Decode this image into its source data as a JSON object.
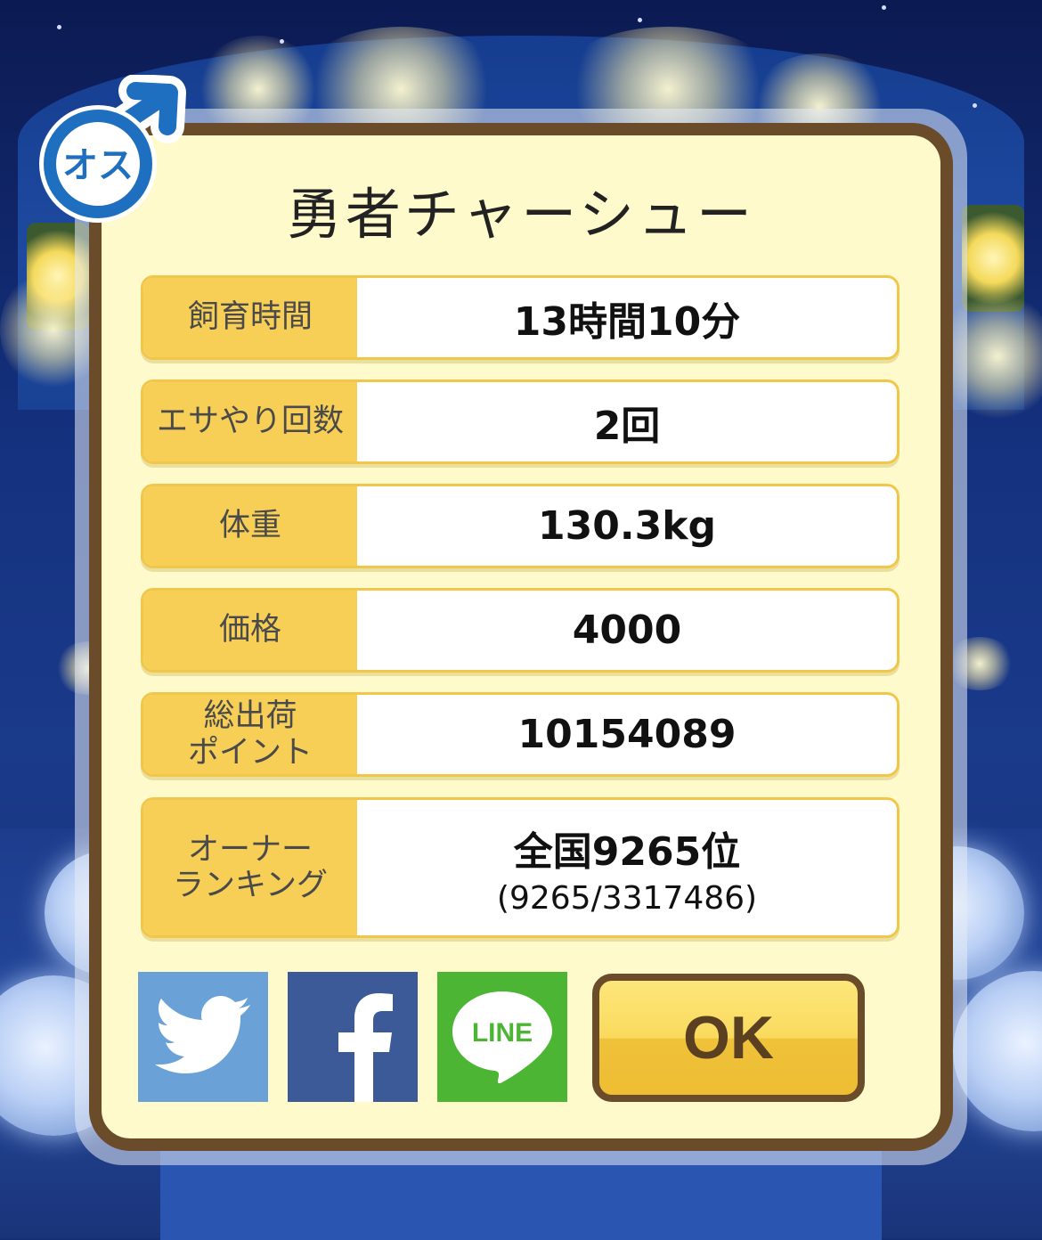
{
  "pig": {
    "name": "勇者チャーシュー",
    "gender_badge": "オス"
  },
  "stats": [
    {
      "label": "飼育時間",
      "value": "13時間10分"
    },
    {
      "label": "エサやり回数",
      "value": "2回"
    },
    {
      "label": "体重",
      "value": "130.3kg"
    },
    {
      "label": "価格",
      "value": "4000"
    },
    {
      "label": "総出荷\nポイント",
      "value": "10154089"
    },
    {
      "label": "オーナー\nランキング",
      "value": "全国9265位",
      "sub": "(9265/3317486)"
    }
  ],
  "share": {
    "twitter_color": "#6aa2d8",
    "facebook_color": "#3b5a97",
    "line_color": "#4cb533",
    "line_label": "LINE"
  },
  "ok_button": {
    "label": "OK"
  },
  "badge_color": "#1f6fc0"
}
